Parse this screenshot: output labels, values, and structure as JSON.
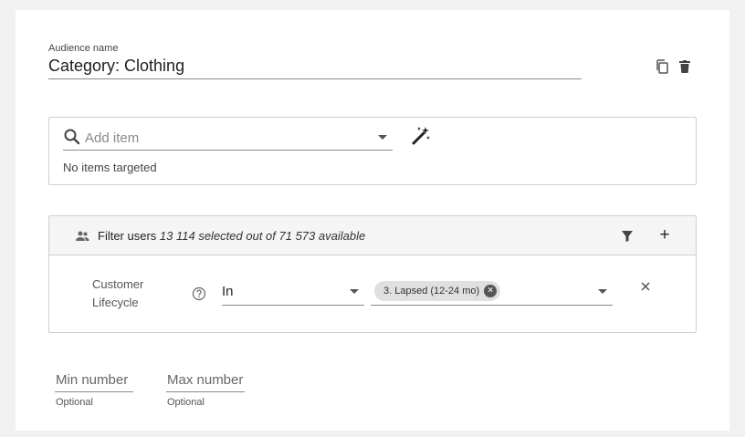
{
  "audience": {
    "name_label": "Audience name",
    "name_value": "Category: Clothing"
  },
  "actions": {
    "copy_icon": "copy-icon",
    "delete_icon": "delete-icon"
  },
  "items": {
    "search_placeholder": "Add item",
    "empty_text": "No items targeted"
  },
  "filter": {
    "title": "Filter users",
    "count_text": "13 114 selected out of 71 573 available",
    "add_label": "+",
    "rule": {
      "label": "Customer Lifecycle",
      "operator": "In",
      "chip": "3. Lapsed (12-24 mo)",
      "chip_remove": "×",
      "remove_label": "×"
    }
  },
  "range": {
    "min_placeholder": "Min number",
    "max_placeholder": "Max number",
    "min_hint": "Optional",
    "max_hint": "Optional"
  }
}
